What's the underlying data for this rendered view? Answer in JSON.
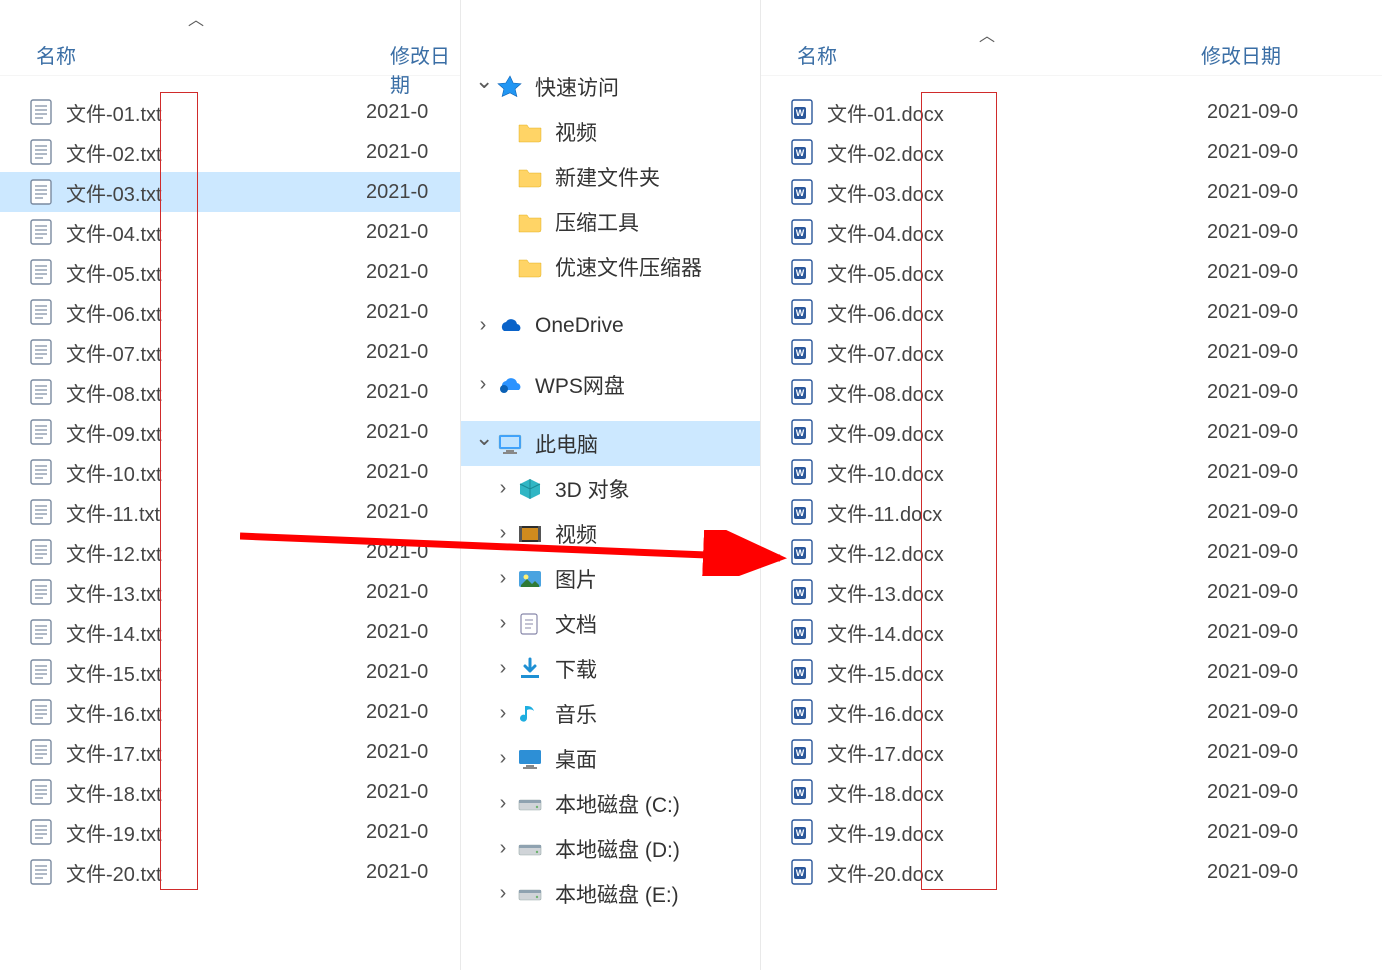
{
  "left": {
    "col_name": "名称",
    "col_date": "修改日期",
    "selected_index": 2,
    "files": [
      {
        "name": "文件-01.txt",
        "date": "2021-0"
      },
      {
        "name": "文件-02.txt",
        "date": "2021-0"
      },
      {
        "name": "文件-03.txt",
        "date": "2021-0"
      },
      {
        "name": "文件-04.txt",
        "date": "2021-0"
      },
      {
        "name": "文件-05.txt",
        "date": "2021-0"
      },
      {
        "name": "文件-06.txt",
        "date": "2021-0"
      },
      {
        "name": "文件-07.txt",
        "date": "2021-0"
      },
      {
        "name": "文件-08.txt",
        "date": "2021-0"
      },
      {
        "name": "文件-09.txt",
        "date": "2021-0"
      },
      {
        "name": "文件-10.txt",
        "date": "2021-0"
      },
      {
        "name": "文件-11.txt",
        "date": "2021-0"
      },
      {
        "name": "文件-12.txt",
        "date": "2021-0"
      },
      {
        "name": "文件-13.txt",
        "date": "2021-0"
      },
      {
        "name": "文件-14.txt",
        "date": "2021-0"
      },
      {
        "name": "文件-15.txt",
        "date": "2021-0"
      },
      {
        "name": "文件-16.txt",
        "date": "2021-0"
      },
      {
        "name": "文件-17.txt",
        "date": "2021-0"
      },
      {
        "name": "文件-18.txt",
        "date": "2021-0"
      },
      {
        "name": "文件-19.txt",
        "date": "2021-0"
      },
      {
        "name": "文件-20.txt",
        "date": "2021-0"
      }
    ]
  },
  "nav": {
    "items": [
      {
        "chev": "down",
        "icon": "star",
        "label": "快速访问",
        "indent": 0
      },
      {
        "chev": "none",
        "icon": "folder",
        "label": "视频",
        "indent": 1
      },
      {
        "chev": "none",
        "icon": "folder",
        "label": "新建文件夹",
        "indent": 1
      },
      {
        "chev": "none",
        "icon": "folder",
        "label": "压缩工具",
        "indent": 1
      },
      {
        "chev": "none",
        "icon": "folder",
        "label": "优速文件压缩器",
        "indent": 1
      },
      {
        "chev": "right",
        "icon": "onedrive",
        "label": "OneDrive",
        "indent": 0
      },
      {
        "chev": "right",
        "icon": "wps",
        "label": "WPS网盘",
        "indent": 0
      },
      {
        "chev": "down",
        "icon": "thispc",
        "label": "此电脑",
        "indent": 0,
        "selected": true
      },
      {
        "chev": "right",
        "icon": "3d",
        "label": "3D 对象",
        "indent": 1
      },
      {
        "chev": "right",
        "icon": "video",
        "label": "视频",
        "indent": 1
      },
      {
        "chev": "right",
        "icon": "pictures",
        "label": "图片",
        "indent": 1
      },
      {
        "chev": "right",
        "icon": "docs",
        "label": "文档",
        "indent": 1
      },
      {
        "chev": "right",
        "icon": "downloads",
        "label": "下载",
        "indent": 1
      },
      {
        "chev": "right",
        "icon": "music",
        "label": "音乐",
        "indent": 1
      },
      {
        "chev": "right",
        "icon": "desktop",
        "label": "桌面",
        "indent": 1
      },
      {
        "chev": "right",
        "icon": "disk",
        "label": "本地磁盘 (C:)",
        "indent": 1
      },
      {
        "chev": "right",
        "icon": "disk",
        "label": "本地磁盘 (D:)",
        "indent": 1
      },
      {
        "chev": "right",
        "icon": "disk",
        "label": "本地磁盘 (E:)",
        "indent": 1
      }
    ]
  },
  "right": {
    "col_name": "名称",
    "col_date": "修改日期",
    "files": [
      {
        "name": "文件-01.docx",
        "date": "2021-09-0"
      },
      {
        "name": "文件-02.docx",
        "date": "2021-09-0"
      },
      {
        "name": "文件-03.docx",
        "date": "2021-09-0"
      },
      {
        "name": "文件-04.docx",
        "date": "2021-09-0"
      },
      {
        "name": "文件-05.docx",
        "date": "2021-09-0"
      },
      {
        "name": "文件-06.docx",
        "date": "2021-09-0"
      },
      {
        "name": "文件-07.docx",
        "date": "2021-09-0"
      },
      {
        "name": "文件-08.docx",
        "date": "2021-09-0"
      },
      {
        "name": "文件-09.docx",
        "date": "2021-09-0"
      },
      {
        "name": "文件-10.docx",
        "date": "2021-09-0"
      },
      {
        "name": "文件-11.docx",
        "date": "2021-09-0"
      },
      {
        "name": "文件-12.docx",
        "date": "2021-09-0"
      },
      {
        "name": "文件-13.docx",
        "date": "2021-09-0"
      },
      {
        "name": "文件-14.docx",
        "date": "2021-09-0"
      },
      {
        "name": "文件-15.docx",
        "date": "2021-09-0"
      },
      {
        "name": "文件-16.docx",
        "date": "2021-09-0"
      },
      {
        "name": "文件-17.docx",
        "date": "2021-09-0"
      },
      {
        "name": "文件-18.docx",
        "date": "2021-09-0"
      },
      {
        "name": "文件-19.docx",
        "date": "2021-09-0"
      },
      {
        "name": "文件-20.docx",
        "date": "2021-09-0"
      }
    ]
  }
}
